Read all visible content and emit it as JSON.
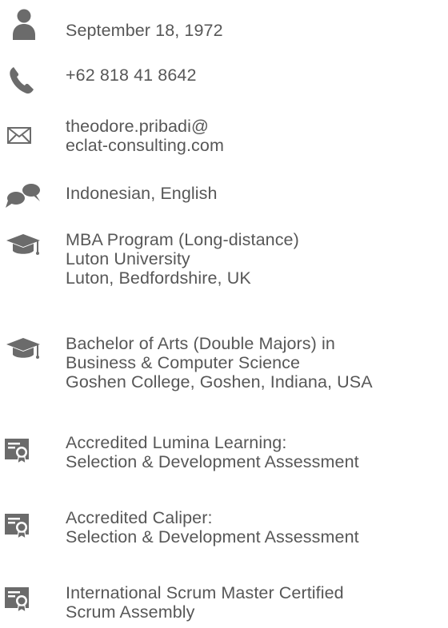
{
  "profile": {
    "birthdate": "September 18, 1972",
    "phone": "+62 818 41 8642",
    "email_line1": "theodore.pribadi@",
    "email_line2": "eclat-consulting.com",
    "languages": "Indonesian, English"
  },
  "education": [
    {
      "lines": [
        "MBA Program (Long-distance)",
        "Luton University",
        "Luton, Bedfordshire, UK"
      ]
    },
    {
      "lines": [
        "Bachelor of Arts (Double Majors) in",
        "Business & Computer Science",
        "Goshen College, Goshen, Indiana, USA"
      ]
    }
  ],
  "certifications": [
    {
      "lines": [
        "Accredited Lumina Learning:",
        "Selection & Development Assessment"
      ]
    },
    {
      "lines": [
        "Accredited Caliper:",
        "Selection & Development Assessment"
      ]
    },
    {
      "lines": [
        "International Scrum Master Certified",
        "Scrum Assembly"
      ]
    }
  ],
  "icons": {
    "birthdate": "person-icon",
    "phone": "phone-icon",
    "email": "envelope-icon",
    "languages": "speech-bubbles-icon",
    "education": "graduation-cap-icon",
    "certification": "certificate-icon"
  },
  "colors": {
    "icon": "#6b6b6b",
    "text": "#575757"
  }
}
